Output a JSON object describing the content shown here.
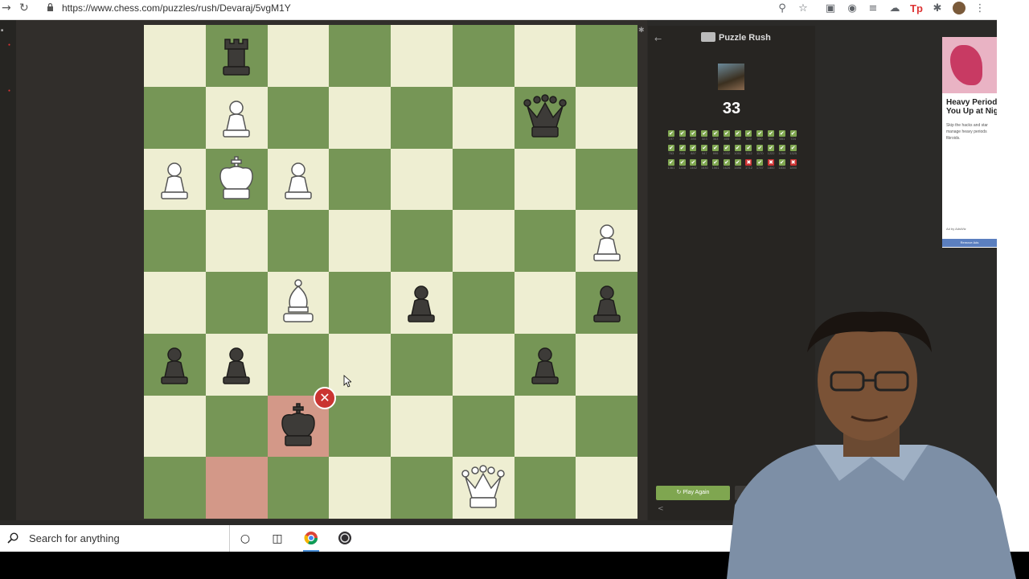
{
  "browser": {
    "url": "https://www.chess.com/puzzles/rush/Devaraj/5vgM1Y",
    "back_icon": "arrow-right-icon",
    "reload_icon": "reload-icon"
  },
  "board": {
    "squares": [
      [
        "",
        "bR",
        "",
        "",
        "",
        "",
        "",
        ""
      ],
      [
        "",
        "wP",
        "",
        "",
        "",
        "",
        "bQ",
        ""
      ],
      [
        "wP",
        "wK",
        "wP",
        "",
        "",
        "",
        "",
        ""
      ],
      [
        "",
        "",
        "",
        "",
        "",
        "",
        "",
        "wP"
      ],
      [
        "",
        "",
        "wB",
        "",
        "bP",
        "",
        "",
        "bP"
      ],
      [
        "bP",
        "bP",
        "",
        "",
        "",
        "",
        "bP",
        ""
      ],
      [
        "",
        "",
        "bK",
        "",
        "",
        "",
        "",
        ""
      ],
      [
        "",
        "",
        "",
        "",
        "",
        "wQ",
        "",
        ""
      ]
    ],
    "highlighted": [
      [
        6,
        2
      ],
      [
        7,
        1
      ]
    ],
    "wrong_marker": "x-icon"
  },
  "panel": {
    "title": "Puzzle Rush",
    "score": "33",
    "results": [
      {
        "s": "ok",
        "n": "197"
      },
      {
        "s": "ok",
        "n": "233"
      },
      {
        "s": "ok",
        "n": "285"
      },
      {
        "s": "ok",
        "n": "323"
      },
      {
        "s": "ok",
        "n": "363"
      },
      {
        "s": "ok",
        "n": "405"
      },
      {
        "s": "ok",
        "n": "450"
      },
      {
        "s": "ok",
        "n": "520"
      },
      {
        "s": "ok",
        "n": "550"
      },
      {
        "s": "ok",
        "n": "553"
      },
      {
        "s": "ok",
        "n": "651"
      },
      {
        "s": "ok",
        "n": "724"
      },
      {
        "s": "ok",
        "n": "763"
      },
      {
        "s": "ok",
        "n": "843"
      },
      {
        "s": "ok",
        "n": "887"
      },
      {
        "s": "ok",
        "n": "947"
      },
      {
        "s": "ok",
        "n": "999"
      },
      {
        "s": "ok",
        "n": "1032"
      },
      {
        "s": "ok",
        "n": "1091"
      },
      {
        "s": "ok",
        "n": "1112"
      },
      {
        "s": "ok",
        "n": "1170"
      },
      {
        "s": "ok",
        "n": "1222"
      },
      {
        "s": "ok",
        "n": "1269"
      },
      {
        "s": "ok",
        "n": "1325"
      },
      {
        "s": "ok",
        "n": "1361"
      },
      {
        "s": "ok",
        "n": "1408"
      },
      {
        "s": "ok",
        "n": "1462"
      },
      {
        "s": "ok",
        "n": "1530"
      },
      {
        "s": "ok",
        "n": "1561"
      },
      {
        "s": "ok",
        "n": "1626"
      },
      {
        "s": "ok",
        "n": "1696"
      },
      {
        "s": "bad",
        "n": "1712"
      },
      {
        "s": "ok",
        "n": "1737"
      },
      {
        "s": "bad",
        "n": "1800"
      },
      {
        "s": "ok",
        "n": "1834"
      },
      {
        "s": "bad",
        "n": "1890"
      }
    ],
    "play_again": "Play Again"
  },
  "ad": {
    "headline_1": "Heavy Period",
    "headline_2": "You Up at Nig",
    "body_1": "Skip the hacks and star",
    "body_2": "manage heavy periods",
    "body_3": "fibroids.",
    "by": "Ad by AdsWiz",
    "remove": "Remove Ads"
  },
  "taskbar": {
    "search_placeholder": "Search for anything"
  },
  "colors": {
    "light_square": "#eeeed2",
    "dark_square": "#769656",
    "highlight": "#d39888",
    "accent_green": "#7fa650"
  }
}
